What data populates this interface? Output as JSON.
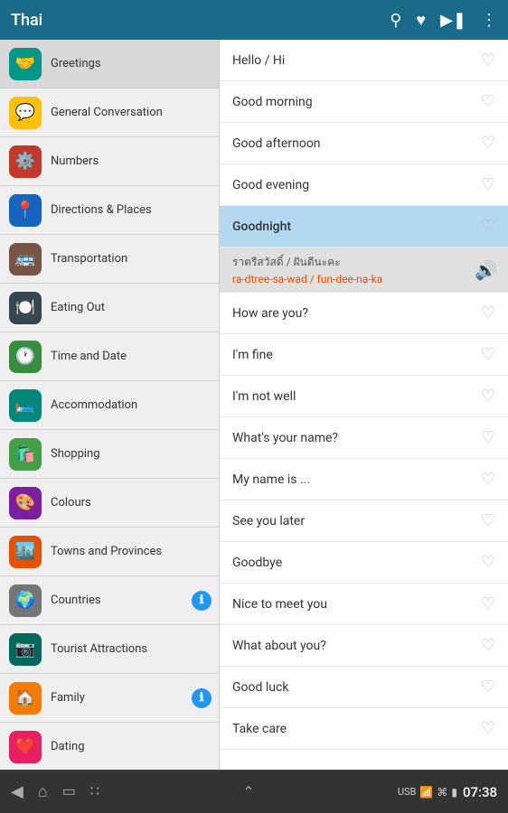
{
  "header": {
    "title": "Thai",
    "icons": [
      "search",
      "favorite",
      "play",
      "more"
    ]
  },
  "sidebar": {
    "items": [
      {
        "id": "greetings",
        "label": "Greetings",
        "icon": "🤝",
        "color": "ic-teal",
        "active": true
      },
      {
        "id": "general-conversation",
        "label": "General Conversation",
        "icon": "💬",
        "color": "ic-yellow",
        "active": false
      },
      {
        "id": "numbers",
        "label": "Numbers",
        "icon": "⚙️",
        "color": "ic-red",
        "active": false
      },
      {
        "id": "directions-places",
        "label": "Directions & Places",
        "icon": "📍",
        "color": "ic-blue-dark",
        "active": false
      },
      {
        "id": "transportation",
        "label": "Transportation",
        "icon": "🚌",
        "color": "ic-brown",
        "active": false
      },
      {
        "id": "eating-out",
        "label": "Eating Out",
        "icon": "🍽️",
        "color": "ic-blue-gray",
        "active": false
      },
      {
        "id": "time-date",
        "label": "Time and Date",
        "icon": "🕐",
        "color": "ic-green",
        "active": false
      },
      {
        "id": "accommodation",
        "label": "Accommodation",
        "icon": "🛏️",
        "color": "ic-teal2",
        "active": false
      },
      {
        "id": "shopping",
        "label": "Shopping",
        "icon": "🛍️",
        "color": "ic-green2",
        "active": false
      },
      {
        "id": "colours",
        "label": "Colours",
        "icon": "🎨",
        "color": "ic-purple",
        "active": false
      },
      {
        "id": "towns-provinces",
        "label": "Towns and Provinces",
        "icon": "🏙️",
        "color": "ic-orange",
        "active": false
      },
      {
        "id": "countries",
        "label": "Countries",
        "icon": "🌍",
        "color": "ic-gray",
        "active": false,
        "badge": "ℹ"
      },
      {
        "id": "tourist-attractions",
        "label": "Tourist Attractions",
        "icon": "📷",
        "color": "ic-dark-teal",
        "active": false
      },
      {
        "id": "family",
        "label": "Family",
        "icon": "🏠",
        "color": "ic-orange2",
        "active": false,
        "badge": "ℹ"
      },
      {
        "id": "dating",
        "label": "Dating",
        "icon": "❤️",
        "color": "ic-pink",
        "active": false
      }
    ]
  },
  "content": {
    "items": [
      {
        "id": "hello",
        "label": "Hello / Hi",
        "highlighted": false,
        "heart": false
      },
      {
        "id": "good-morning",
        "label": "Good morning",
        "highlighted": false,
        "heart": false
      },
      {
        "id": "good-afternoon",
        "label": "Good afternoon",
        "highlighted": false,
        "heart": false
      },
      {
        "id": "good-evening",
        "label": "Good evening",
        "highlighted": false,
        "heart": false
      },
      {
        "id": "goodnight",
        "label": "Goodnight",
        "highlighted": true,
        "heart": false
      },
      {
        "id": "translation",
        "type": "translation",
        "thai": "ราตรีสวัสดิ์ / ฝันดีนะคะ",
        "phonetic": "ra-dtree-sa-wad / fun-dee-na-ka"
      },
      {
        "id": "how-are-you",
        "label": "How are you?",
        "highlighted": false,
        "heart": false
      },
      {
        "id": "im-fine",
        "label": "I'm fine",
        "highlighted": false,
        "heart": false
      },
      {
        "id": "im-not-well",
        "label": "I'm not well",
        "highlighted": false,
        "heart": false
      },
      {
        "id": "whats-your-name",
        "label": "What's your name?",
        "highlighted": false,
        "heart": false
      },
      {
        "id": "my-name-is",
        "label": "My name is ...",
        "highlighted": false,
        "heart": false
      },
      {
        "id": "see-you-later",
        "label": "See you later",
        "highlighted": false,
        "heart": false
      },
      {
        "id": "goodbye",
        "label": "Goodbye",
        "highlighted": false,
        "heart": false
      },
      {
        "id": "nice-to-meet-you",
        "label": "Nice to meet you",
        "highlighted": false,
        "heart": false
      },
      {
        "id": "what-about-you",
        "label": "What about you?",
        "highlighted": false,
        "heart": false
      },
      {
        "id": "good-luck",
        "label": "Good luck",
        "highlighted": false,
        "heart": false
      },
      {
        "id": "take-care",
        "label": "Take care",
        "highlighted": false,
        "heart": false
      }
    ]
  },
  "bottom_nav": {
    "icons": [
      "back",
      "home",
      "recent",
      "grid"
    ]
  },
  "status_bar": {
    "time": "07:38",
    "icons": [
      "usb",
      "signal",
      "wifi",
      "battery"
    ]
  }
}
